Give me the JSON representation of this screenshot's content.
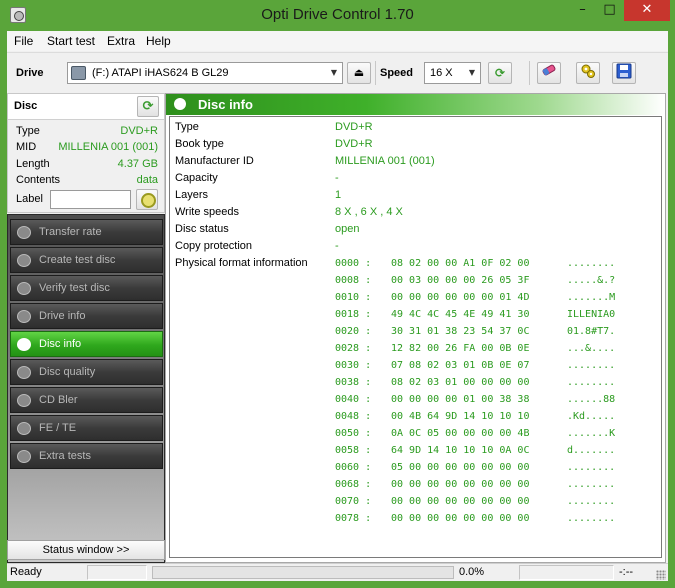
{
  "window": {
    "title": "Opti Drive Control 1.70",
    "min_glyph": "–",
    "max_glyph": "□",
    "close_glyph": "✕"
  },
  "menu": {
    "items": [
      "File",
      "Start test",
      "Extra",
      "Help"
    ]
  },
  "toolbar": {
    "drive_label": "Drive",
    "drive_value": "(F:)   ATAPI iHAS624   B GL29",
    "speed_label": "Speed",
    "speed_value": "16 X",
    "eject_glyph": "⏏",
    "refresh_glyph": "⟳"
  },
  "disc_panel": {
    "title": "Disc",
    "refresh_glyph": "⟳",
    "rows": [
      {
        "key": "Type",
        "value": "DVD+R"
      },
      {
        "key": "MID",
        "value": "MILLENIA 001 (001)"
      },
      {
        "key": "Length",
        "value": "4.37 GB"
      },
      {
        "key": "Contents",
        "value": "data"
      }
    ],
    "label_key": "Label",
    "label_value": ""
  },
  "nav": {
    "items": [
      {
        "label": "Transfer rate",
        "active": false
      },
      {
        "label": "Create test disc",
        "active": false
      },
      {
        "label": "Verify test disc",
        "active": false
      },
      {
        "label": "Drive info",
        "active": false
      },
      {
        "label": "Disc info",
        "active": true
      },
      {
        "label": "Disc quality",
        "active": false
      },
      {
        "label": "CD Bler",
        "active": false
      },
      {
        "label": "FE / TE",
        "active": false
      },
      {
        "label": "Extra tests",
        "active": false
      }
    ]
  },
  "status_window_button": "Status window >>",
  "main": {
    "title": "Disc info",
    "rows": [
      {
        "key": "Type",
        "value": "DVD+R"
      },
      {
        "key": "Book type",
        "value": "DVD+R"
      },
      {
        "key": "Manufacturer ID",
        "value": "MILLENIA 001 (001)"
      },
      {
        "key": "Capacity",
        "value": "-"
      },
      {
        "key": "Layers",
        "value": "1"
      },
      {
        "key": "Write speeds",
        "value": "8 X , 6 X , 4 X"
      },
      {
        "key": "Disc status",
        "value": "open"
      },
      {
        "key": "Copy protection",
        "value": "-"
      }
    ],
    "pfi_label": "Physical format information",
    "hex": [
      {
        "offset": "0000 :",
        "bytes": "08 02 00 00 A1 0F 02 00",
        "ascii": "........"
      },
      {
        "offset": "0008 :",
        "bytes": "00 03 00 00 00 26 05 3F",
        "ascii": ".....&.?"
      },
      {
        "offset": "0010 :",
        "bytes": "00 00 00 00 00 00 01 4D",
        "ascii": ".......M"
      },
      {
        "offset": "0018 :",
        "bytes": "49 4C 4C 45 4E 49 41 30",
        "ascii": "ILLENIA0"
      },
      {
        "offset": "0020 :",
        "bytes": "30 31 01 38 23 54 37 0C",
        "ascii": "01.8#T7."
      },
      {
        "offset": "0028 :",
        "bytes": "12 82 00 26 FA 00 0B 0E",
        "ascii": "...&...."
      },
      {
        "offset": "0030 :",
        "bytes": "07 08 02 03 01 0B 0E 07",
        "ascii": "........"
      },
      {
        "offset": "0038 :",
        "bytes": "08 02 03 01 00 00 00 00",
        "ascii": "........"
      },
      {
        "offset": "0040 :",
        "bytes": "00 00 00 00 01 00 38 38",
        "ascii": "......88"
      },
      {
        "offset": "0048 :",
        "bytes": "00 4B 64 9D 14 10 10 10",
        "ascii": ".Kd....."
      },
      {
        "offset": "0050 :",
        "bytes": "0A 0C 05 00 00 00 00 4B",
        "ascii": ".......K"
      },
      {
        "offset": "0058 :",
        "bytes": "64 9D 14 10 10 10 0A 0C",
        "ascii": "d......."
      },
      {
        "offset": "0060 :",
        "bytes": "05 00 00 00 00 00 00 00",
        "ascii": "........"
      },
      {
        "offset": "0068 :",
        "bytes": "00 00 00 00 00 00 00 00",
        "ascii": "........"
      },
      {
        "offset": "0070 :",
        "bytes": "00 00 00 00 00 00 00 00",
        "ascii": "........"
      },
      {
        "offset": "0078 :",
        "bytes": "00 00 00 00 00 00 00 00",
        "ascii": "........"
      }
    ]
  },
  "statusbar": {
    "ready": "Ready",
    "percent": "0.0%",
    "progress": 0,
    "time": "-:--"
  },
  "colors": {
    "accent": "#2b9b1f",
    "titlebar": "#5aa53a",
    "close": "#c7362d"
  }
}
